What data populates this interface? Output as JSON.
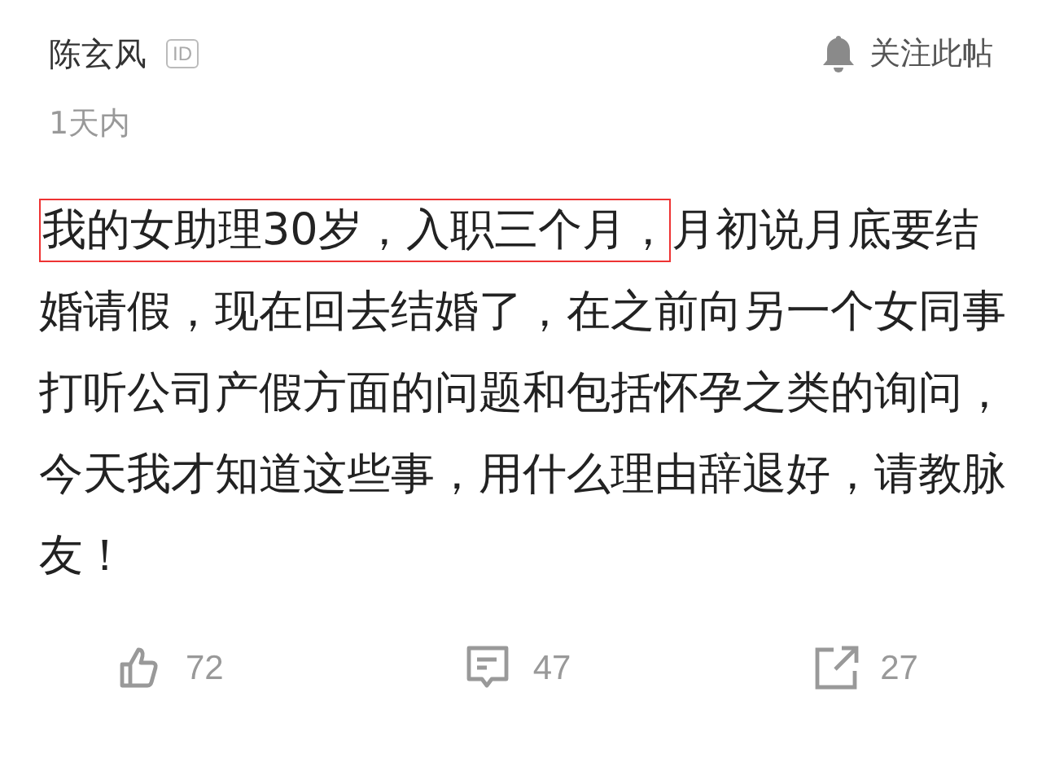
{
  "author": {
    "name": "陈玄风",
    "badge": "ID"
  },
  "follow": {
    "label": "关注此帖"
  },
  "time": "1天内",
  "post": {
    "highlighted": "我的女助理30岁，入职三个月，",
    "text": "月初说月底要结婚请假，现在回去结婚了，在之前向另一个女同事打听公司产假方面的问题和包括怀孕之类的询问，今天我才知道这些事，用什么理由辞退好，请教脉友！"
  },
  "actions": [
    {
      "kind": "like",
      "count": "72"
    },
    {
      "kind": "comment",
      "count": "47"
    },
    {
      "kind": "share",
      "count": "27"
    }
  ]
}
